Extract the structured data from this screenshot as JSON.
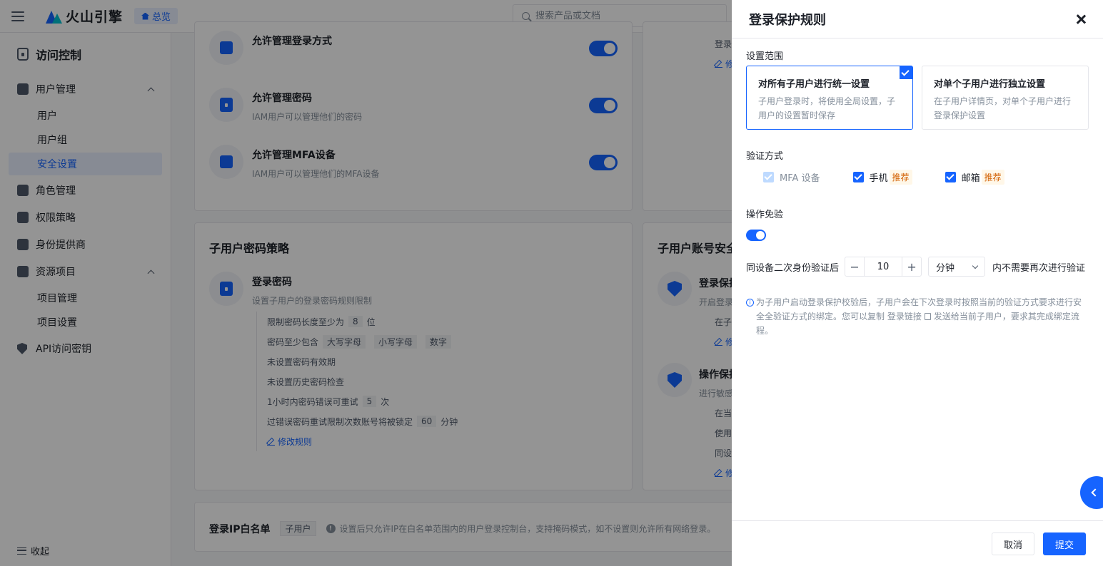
{
  "topbar": {
    "brand": "火山引擎",
    "overview": "总览",
    "search_placeholder": "搜索产品或文档"
  },
  "sidebar": {
    "title": "访问控制",
    "groups": [
      {
        "label": "用户管理",
        "items": [
          "用户",
          "用户组",
          "安全设置"
        ]
      },
      {
        "label": "角色管理"
      },
      {
        "label": "权限策略"
      },
      {
        "label": "身份提供商"
      },
      {
        "label": "资源项目",
        "items": [
          "项目管理",
          "项目设置"
        ]
      },
      {
        "label": "API访问密钥"
      }
    ],
    "collapse": "收起"
  },
  "main": {
    "perms": [
      {
        "title": "允许管理登录方式",
        "desc": ""
      },
      {
        "title": "允许管理密码",
        "desc": "IAM用户可以管理他们的密码"
      },
      {
        "title": "允许管理MFA设备",
        "desc": "IAM用户可以管理他们的MFA设备"
      }
    ],
    "right_top": {
      "line1": "登录",
      "line2": "修"
    },
    "password_policy": {
      "title": "子用户密码策略",
      "item_title": "登录密码",
      "item_desc": "设置子用户的登录密码规则限制",
      "rule_len_pre": "限制密码长度至少为",
      "rule_len_val": "8",
      "rule_len_post": "位",
      "rule_contain_pre": "密码至少包含",
      "tag_upper": "大写字母",
      "tag_lower": "小写字母",
      "tag_digit": "数字",
      "rule_expire": "未设置密码有效期",
      "rule_history": "未设置历史密码检查",
      "rule_retry_pre": "1小时内密码错误可重试",
      "rule_retry_val": "5",
      "rule_retry_post": "次",
      "rule_lock_pre": "过错误密码重试限制次数账号将被锁定",
      "rule_lock_val": "60",
      "rule_lock_post": "分钟",
      "edit": "修改规则"
    },
    "account_security": {
      "title": "子用户账号安全",
      "login_title": "登录保护",
      "login_desc": "开启登录",
      "login_sub1": "在子",
      "login_sub2": "修",
      "op_title": "操作保护",
      "op_desc": "进行敏感",
      "op_sub1": "在当",
      "op_sub2": "使用",
      "op_sub3": "同设",
      "op_sub4": "修"
    },
    "ip_whitelist": {
      "title": "登录IP白名单",
      "tag": "子用户",
      "desc": "设置后只允许IP在白名单范围内的用户登录控制台，支持掩码模式，如不设置则允许所有网络登录。"
    }
  },
  "drawer": {
    "title": "登录保护规则",
    "scope_label": "设置范围",
    "scope_all_title": "对所有子用户进行统一设置",
    "scope_all_desc": "子用户登录时，将使用全局设置，子用户的设置暂时保存",
    "scope_single_title": "对单个子用户进行独立设置",
    "scope_single_desc": "在子用户详情页，对单个子用户进行登录保护设置",
    "verify_label": "验证方式",
    "methods": [
      {
        "label": "MFA 设备",
        "checked": true,
        "disabled": true,
        "badge": ""
      },
      {
        "label": "手机",
        "checked": true,
        "disabled": false,
        "badge": "推荐"
      },
      {
        "label": "邮箱",
        "checked": true,
        "disabled": false,
        "badge": "推荐"
      }
    ],
    "exempt_label": "操作免验",
    "exempt_on": true,
    "repeat_pre": "同设备二次身份验证后",
    "repeat_value": "10",
    "repeat_unit": "分钟",
    "repeat_post": "内不需要再次进行验证",
    "note_pre": "为子用户启动登录保护校验后，子用户会在下次登录时按照当前的验证方式要求进行安全全验证方式的绑定。您可以复制 登录链接",
    "note_post": "发送给当前子用户，要求其完成绑定流程。",
    "cancel": "取消",
    "submit": "提交"
  },
  "colors": {
    "primary": "#1664ff",
    "badge_bg": "#fff7e8",
    "badge_text": "#d25f00"
  }
}
